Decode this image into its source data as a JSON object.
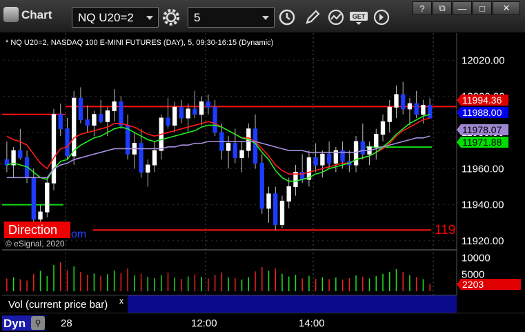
{
  "window": {
    "app_title": "Chart",
    "symbol": "NQ U20=2",
    "interval": "5",
    "buttons": {
      "help": "?",
      "restore": "⧉",
      "minimize": "—",
      "maximize": "□",
      "close": "✕"
    }
  },
  "chart": {
    "header": "* NQ U20=2, NASDAQ 100 E-MINI FUTURES (DAY), 5, 09:30-16:15 (Dynamic)",
    "copyright": "© eSignal, 2020",
    "direction_label": "Direction",
    "direction_suffix": "om",
    "offscreen_price_fragment": "119",
    "price_ticks": [
      {
        "v": 12020,
        "label": "12020.00"
      },
      {
        "v": 12000,
        "label": "12000.00"
      },
      {
        "v": 11980,
        "label": "11980.00"
      },
      {
        "v": 11960,
        "label": "11960.00"
      },
      {
        "v": 11940,
        "label": "11940.00"
      },
      {
        "v": 11920,
        "label": "11920.00"
      }
    ],
    "price_tags": [
      {
        "v": 11994.36,
        "label": "11994.36",
        "bg": "#e00000",
        "fg": "#ffffff"
      },
      {
        "v": 11988.0,
        "label": "11988.00",
        "bg": "#0000ee",
        "fg": "#ffffff"
      },
      {
        "v": 11978.07,
        "label": "11978.07",
        "bg": "#9f86d1",
        "fg": "#000000"
      },
      {
        "v": 11971.88,
        "label": "11971.88",
        "bg": "#00dd00",
        "fg": "#000000"
      }
    ],
    "levels": {
      "red_top": 11994.36,
      "red_bottom": 11926,
      "red_left_top": 11990,
      "green_left": 11940
    }
  },
  "volume": {
    "ticks": [
      {
        "label": "10000"
      },
      {
        "label": "5000"
      }
    ],
    "last_tag": "2203",
    "study_label": "Vol (current price bar)",
    "close": "x"
  },
  "time_axis": {
    "dyn_label": "Dyn",
    "labels": [
      "28",
      "12:00",
      "14:00"
    ]
  },
  "chart_data": {
    "type": "candlestick",
    "symbol": "NQ U20=2",
    "interval_minutes": 5,
    "ylim": [
      11915,
      12035
    ],
    "series": [
      {
        "name": "price",
        "ohlc": [
          [
            11965,
            11975,
            11958,
            11962
          ],
          [
            11962,
            11972,
            11955,
            11970
          ],
          [
            11970,
            11982,
            11965,
            11966
          ],
          [
            11966,
            11970,
            11952,
            11955
          ],
          [
            11955,
            11960,
            11930,
            11932
          ],
          [
            11932,
            11940,
            11928,
            11936
          ],
          [
            11936,
            11955,
            11933,
            11952
          ],
          [
            11952,
            11993,
            11948,
            11990
          ],
          [
            11990,
            11996,
            11978,
            11982
          ],
          [
            11982,
            11988,
            11965,
            11967
          ],
          [
            11967,
            12003,
            11962,
            11999
          ],
          [
            11999,
            12005,
            11985,
            11987
          ],
          [
            11987,
            11995,
            11980,
            11984
          ],
          [
            11984,
            11992,
            11978,
            11990
          ],
          [
            11990,
            11998,
            11985,
            11986
          ],
          [
            11986,
            11994,
            11978,
            11992
          ],
          [
            11992,
            12004,
            11986,
            11997
          ],
          [
            11997,
            12000,
            11982,
            11984
          ],
          [
            11984,
            11990,
            11965,
            11968
          ],
          [
            11968,
            11980,
            11960,
            11974
          ],
          [
            11974,
            11982,
            11955,
            11958
          ],
          [
            11958,
            11965,
            11950,
            11962
          ],
          [
            11962,
            11975,
            11958,
            11970
          ],
          [
            11970,
            11990,
            11965,
            11988
          ],
          [
            11988,
            11999,
            11982,
            11984
          ],
          [
            11984,
            11997,
            11980,
            11994
          ],
          [
            11994,
            11998,
            11985,
            11988
          ],
          [
            11988,
            11996,
            11980,
            11993
          ],
          [
            11993,
            12003,
            11988,
            11990
          ],
          [
            11990,
            12000,
            11984,
            11997
          ],
          [
            11997,
            12001,
            11990,
            11994
          ],
          [
            11994,
            11998,
            11978,
            11980
          ],
          [
            11980,
            11985,
            11965,
            11970
          ],
          [
            11970,
            11978,
            11960,
            11974
          ],
          [
            11974,
            11982,
            11963,
            11966
          ],
          [
            11966,
            11975,
            11958,
            11970
          ],
          [
            11970,
            11985,
            11966,
            11982
          ],
          [
            11982,
            11990,
            11960,
            11963
          ],
          [
            11963,
            11968,
            11935,
            11938
          ],
          [
            11938,
            11950,
            11930,
            11946
          ],
          [
            11946,
            11950,
            11926,
            11929
          ],
          [
            11929,
            11945,
            11927,
            11942
          ],
          [
            11942,
            11955,
            11938,
            11950
          ],
          [
            11950,
            11962,
            11945,
            11958
          ],
          [
            11958,
            11968,
            11952,
            11954
          ],
          [
            11954,
            11970,
            11950,
            11966
          ],
          [
            11966,
            11974,
            11958,
            11962
          ],
          [
            11962,
            11970,
            11955,
            11968
          ],
          [
            11968,
            11975,
            11960,
            11963
          ],
          [
            11963,
            11972,
            11958,
            11970
          ],
          [
            11970,
            11975,
            11960,
            11964
          ],
          [
            11964,
            11970,
            11958,
            11962
          ],
          [
            11962,
            11978,
            11958,
            11975
          ],
          [
            11975,
            11985,
            11965,
            11968
          ],
          [
            11968,
            11975,
            11962,
            11972
          ],
          [
            11972,
            11982,
            11965,
            11979
          ],
          [
            11979,
            11990,
            11975,
            11986
          ],
          [
            11986,
            11998,
            11980,
            11994
          ],
          [
            11994,
            12006,
            11988,
            12001
          ],
          [
            12001,
            12008,
            11990,
            11993
          ],
          [
            11993,
            11999,
            11984,
            11996
          ],
          [
            11996,
            12003,
            11988,
            11990
          ],
          [
            11990,
            11998,
            11985,
            11995
          ],
          [
            11995,
            11999,
            11988,
            11988
          ]
        ]
      },
      {
        "name": "red_ma",
        "values": [
          11978,
          11976,
          11975,
          11973,
          11968,
          11963,
          11960,
          11966,
          11971,
          11972,
          11977,
          11979,
          11980,
          11981,
          11982,
          11983,
          11985,
          11985,
          11984,
          11983,
          11981,
          11979,
          11978,
          11979,
          11980,
          11981,
          11982,
          11983,
          11984,
          11985,
          11986,
          11985,
          11983,
          11981,
          11979,
          11977,
          11977,
          11975,
          11971,
          11967,
          11962,
          11959,
          11957,
          11957,
          11957,
          11958,
          11959,
          11960,
          11961,
          11962,
          11963,
          11963,
          11965,
          11966,
          11967,
          11969,
          11971,
          11974,
          11978,
          11981,
          11983,
          11985,
          11987,
          11988
        ]
      },
      {
        "name": "green_ma",
        "values": [
          11962,
          11963,
          11962,
          11961,
          11958,
          11955,
          11954,
          11960,
          11964,
          11965,
          11970,
          11973,
          11975,
          11977,
          11978,
          11980,
          11982,
          11983,
          11982,
          11980,
          11978,
          11976,
          11975,
          11976,
          11977,
          11978,
          11979,
          11980,
          11981,
          11983,
          11984,
          11984,
          11983,
          11981,
          11979,
          11977,
          11976,
          11974,
          11969,
          11965,
          11959,
          11955,
          11953,
          11953,
          11954,
          11955,
          11957,
          11958,
          11960,
          11961,
          11962,
          11963,
          11965,
          11966,
          11967,
          11969,
          11972,
          11975,
          11979,
          11982,
          11985,
          11987,
          11989,
          11990
        ]
      },
      {
        "name": "purple_ma",
        "values": [
          11955,
          11955,
          11955,
          11955,
          11955,
          11955,
          11955,
          11960,
          11962,
          11963,
          11965,
          11966,
          11967,
          11968,
          11969,
          11970,
          11971,
          11971,
          11971,
          11971,
          11971,
          11971,
          11971,
          11971,
          11972,
          11972,
          11973,
          11973,
          11974,
          11974,
          11975,
          11975,
          11975,
          11975,
          11975,
          11975,
          11975,
          11975,
          11974,
          11973,
          11972,
          11971,
          11970,
          11970,
          11970,
          11969,
          11969,
          11969,
          11969,
          11969,
          11969,
          11969,
          11969,
          11970,
          11970,
          11971,
          11972,
          11973,
          11974,
          11975,
          11976,
          11977,
          11977,
          11978
        ]
      }
    ],
    "volume": [
      3800,
      4200,
      3600,
      3200,
      5200,
      6100,
      4500,
      7800,
      8600,
      6200,
      7400,
      5800,
      4900,
      5300,
      4600,
      5100,
      6200,
      5400,
      6800,
      4700,
      5200,
      4300,
      3900,
      4800,
      5600,
      4100,
      3700,
      4400,
      5000,
      4300,
      3800,
      4900,
      5600,
      4100,
      3900,
      3500,
      4200,
      5900,
      7200,
      6100,
      6800,
      5200,
      4400,
      4900,
      3800,
      4600,
      3700,
      4200,
      3600,
      4100,
      3500,
      3900,
      4700,
      4300,
      3800,
      4500,
      5200,
      5800,
      6600,
      5700,
      4800,
      4200,
      3600,
      2203
    ]
  }
}
